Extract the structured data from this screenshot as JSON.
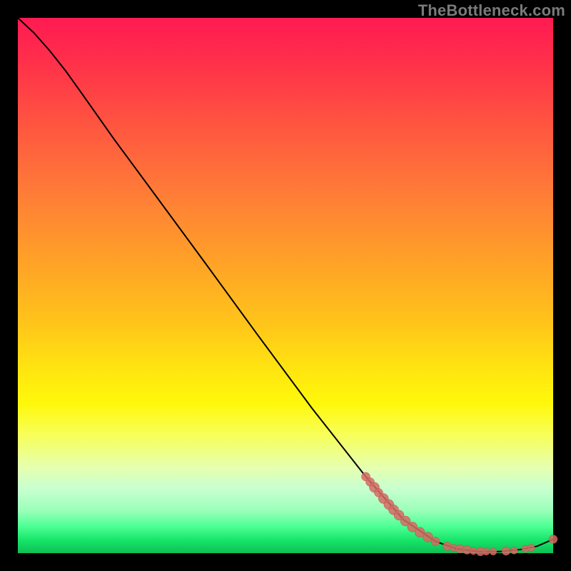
{
  "watermark": "TheBottleneck.com",
  "colors": {
    "marker_fill": "#d66a63",
    "marker_stroke": "#b94f4a",
    "curve": "#000000"
  },
  "chart_data": {
    "type": "line",
    "title": "",
    "xlabel": "",
    "ylabel": "",
    "xlim": [
      0,
      100
    ],
    "ylim": [
      0,
      100
    ],
    "curve": [
      {
        "x": 0,
        "y": 100
      },
      {
        "x": 3,
        "y": 97.2
      },
      {
        "x": 6,
        "y": 93.8
      },
      {
        "x": 9,
        "y": 90.0
      },
      {
        "x": 12,
        "y": 85.8
      },
      {
        "x": 18,
        "y": 77.3
      },
      {
        "x": 25,
        "y": 67.8
      },
      {
        "x": 35,
        "y": 54.2
      },
      {
        "x": 45,
        "y": 40.5
      },
      {
        "x": 55,
        "y": 27.0
      },
      {
        "x": 65,
        "y": 14.3
      },
      {
        "x": 72,
        "y": 6.3
      },
      {
        "x": 78,
        "y": 2.2
      },
      {
        "x": 82,
        "y": 0.8
      },
      {
        "x": 86,
        "y": 0.3
      },
      {
        "x": 90,
        "y": 0.3
      },
      {
        "x": 94,
        "y": 0.7
      },
      {
        "x": 97,
        "y": 1.3
      },
      {
        "x": 100,
        "y": 2.6
      }
    ],
    "series": [
      {
        "name": "points",
        "points": [
          {
            "x": 65.0,
            "y": 14.3,
            "r": 6
          },
          {
            "x": 65.8,
            "y": 13.3,
            "r": 6
          },
          {
            "x": 66.6,
            "y": 12.3,
            "r": 7
          },
          {
            "x": 67.4,
            "y": 11.3,
            "r": 6
          },
          {
            "x": 68.3,
            "y": 10.2,
            "r": 7
          },
          {
            "x": 69.3,
            "y": 9.1,
            "r": 7
          },
          {
            "x": 70.2,
            "y": 8.1,
            "r": 7
          },
          {
            "x": 71.2,
            "y": 7.1,
            "r": 7
          },
          {
            "x": 72.4,
            "y": 6.0,
            "r": 7
          },
          {
            "x": 73.7,
            "y": 4.9,
            "r": 7
          },
          {
            "x": 75.1,
            "y": 3.9,
            "r": 7
          },
          {
            "x": 76.6,
            "y": 3.0,
            "r": 7
          },
          {
            "x": 78.0,
            "y": 2.2,
            "r": 6
          },
          {
            "x": 80.2,
            "y": 1.3,
            "r": 6
          },
          {
            "x": 81.4,
            "y": 1.0,
            "r": 5
          },
          {
            "x": 82.6,
            "y": 0.8,
            "r": 6
          },
          {
            "x": 83.9,
            "y": 0.6,
            "r": 6
          },
          {
            "x": 85.1,
            "y": 0.4,
            "r": 5
          },
          {
            "x": 86.4,
            "y": 0.3,
            "r": 6
          },
          {
            "x": 87.5,
            "y": 0.3,
            "r": 5
          },
          {
            "x": 88.8,
            "y": 0.3,
            "r": 5
          },
          {
            "x": 91.2,
            "y": 0.4,
            "r": 6
          },
          {
            "x": 92.7,
            "y": 0.5,
            "r": 5
          },
          {
            "x": 94.8,
            "y": 0.8,
            "r": 5
          },
          {
            "x": 95.9,
            "y": 1.0,
            "r": 5
          },
          {
            "x": 100.0,
            "y": 2.6,
            "r": 6
          }
        ]
      }
    ]
  }
}
